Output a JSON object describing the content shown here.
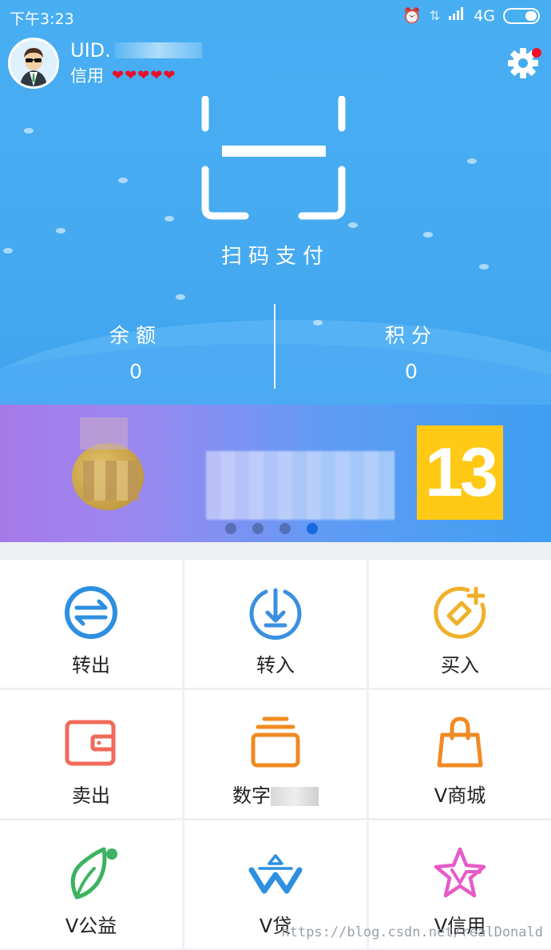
{
  "status_bar": {
    "time": "下午3:23",
    "network": "4G"
  },
  "user": {
    "uid_prefix": "UID.",
    "credit_label": "信用",
    "hearts": "❤❤❤❤❤"
  },
  "scan": {
    "label": "扫码支付"
  },
  "stats": [
    {
      "label": "余额",
      "value": "0"
    },
    {
      "label": "积分",
      "value": "0"
    }
  ],
  "banner": {
    "badge_number": "13",
    "page_count": 4,
    "active_page": 4
  },
  "menu": [
    {
      "label": "转出",
      "icon": "transfer-out-icon",
      "color": "#2d8fe0"
    },
    {
      "label": "转入",
      "icon": "transfer-in-icon",
      "color": "#3b8fe0"
    },
    {
      "label": "买入",
      "icon": "buy-icon",
      "color": "#f0b02a"
    },
    {
      "label": "卖出",
      "icon": "wallet-icon",
      "color": "#f06a5a"
    },
    {
      "label": "数字",
      "icon": "stack-icon",
      "color": "#f08a22"
    },
    {
      "label": "V商城",
      "icon": "shopping-bag-icon",
      "color": "#f08a22"
    },
    {
      "label": "V公益",
      "icon": "leaf-icon",
      "color": "#3cb360"
    },
    {
      "label": "V贷",
      "icon": "loan-icon",
      "color": "#2d8fe0"
    },
    {
      "label": "V信用",
      "icon": "star-credit-icon",
      "color": "#e85ac8"
    }
  ],
  "watermark": "https://blog.csdn.net/realDonald"
}
